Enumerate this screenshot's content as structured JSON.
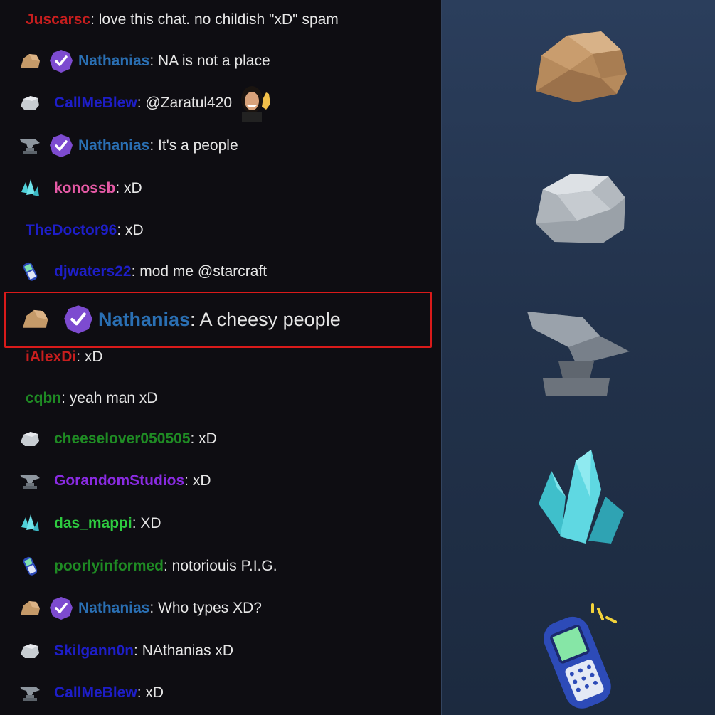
{
  "colors": {
    "red_user": "#c81e1e",
    "blue_sub": "#2a6fb3",
    "dark_blue": "#1e1ec8",
    "pink": "#e65aa6",
    "green": "#1f8b24",
    "purple": "#8a2be2",
    "lime": "#2ecc40",
    "text": "#e6e6e6",
    "highlight_border": "#d91a1a"
  },
  "chat": {
    "messages": [
      {
        "user": "Juscarsc",
        "text": ": love this chat. no childish \"xD\" spam",
        "badges": []
      },
      {
        "user": "Nathanias",
        "text": ": NA is not a place",
        "badges": [
          "rock-icon",
          "verified-badge-icon"
        ]
      },
      {
        "user": "CallMeBlew",
        "text": ": @Zaratul420",
        "badges": [
          "stone-icon"
        ],
        "emote": "waving-woman-emote"
      },
      {
        "user": "Nathanias",
        "text": ": It's a people",
        "badges": [
          "anvil-icon",
          "verified-badge-icon"
        ]
      },
      {
        "user": "konossb",
        "text": ": xD",
        "badges": [
          "crystal-icon"
        ]
      },
      {
        "user": "TheDoctor96",
        "text": ": xD",
        "badges": []
      },
      {
        "user": "djwaters22",
        "text": ": mod me @starcraft",
        "badges": [
          "phone-icon"
        ]
      },
      {
        "user": "Nathanias",
        "text": ": A cheesy people",
        "badges": [
          "rock-icon",
          "verified-badge-icon"
        ]
      },
      {
        "user": "iAlexDi",
        "text": ": xD",
        "badges": []
      },
      {
        "user": "cqbn",
        "text": ": yeah man xD",
        "badges": []
      },
      {
        "user": "cheeselover050505",
        "text": ": xD",
        "badges": [
          "stone-icon"
        ]
      },
      {
        "user": "GorandomStudios",
        "text": ": xD",
        "badges": [
          "anvil-icon"
        ]
      },
      {
        "user": "das_mappi",
        "text": ": XD",
        "badges": [
          "crystal-icon"
        ]
      },
      {
        "user": "poorlyinformed",
        "text": ": notoriouis P.I.G.",
        "badges": [
          "phone-icon"
        ]
      },
      {
        "user": "Nathanias",
        "text": ": Who types XD?",
        "badges": [
          "rock-icon",
          "verified-badge-icon"
        ]
      },
      {
        "user": "Skilgann0n",
        "text": ": NAthanias xD",
        "badges": [
          "stone-icon"
        ]
      },
      {
        "user": "CallMeBlew",
        "text": ": xD",
        "badges": [
          "anvil-icon"
        ]
      }
    ]
  },
  "tiers": [
    "rock-icon",
    "stone-icon",
    "anvil-icon",
    "crystal-icon",
    "phone-icon"
  ]
}
